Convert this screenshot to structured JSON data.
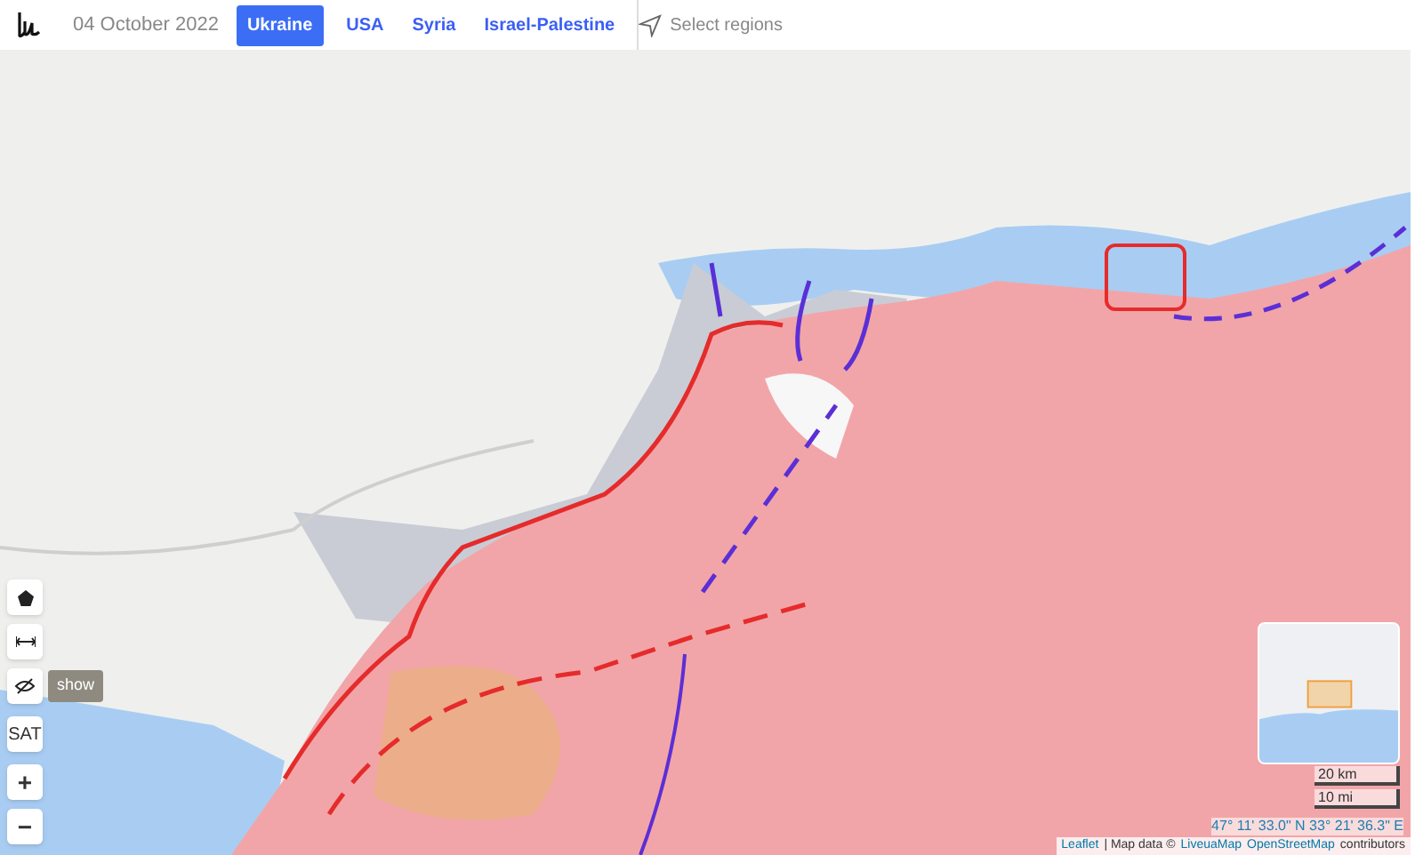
{
  "header": {
    "date": "04 October 2022",
    "tabs": [
      {
        "label": "Ukraine",
        "selected": true
      },
      {
        "label": "USA",
        "selected": false
      },
      {
        "label": "Syria",
        "selected": false
      },
      {
        "label": "Israel-Palestine",
        "selected": false
      }
    ],
    "select_regions": "Select regions"
  },
  "map_controls": {
    "toggle_label": "show",
    "satellite": "SAT",
    "zoom_in": "+",
    "zoom_out": "−"
  },
  "scale": [
    "20 km",
    "10 mi"
  ],
  "coordinates": "47° 11' 33.0\" N 33° 21' 36.3\" E",
  "attribution": {
    "leaflet": "Leaflet",
    "text": "| Map data ©",
    "providers": [
      "LiveuaMap",
      "OpenStreetMap"
    ],
    "suffix": "contributors"
  }
}
